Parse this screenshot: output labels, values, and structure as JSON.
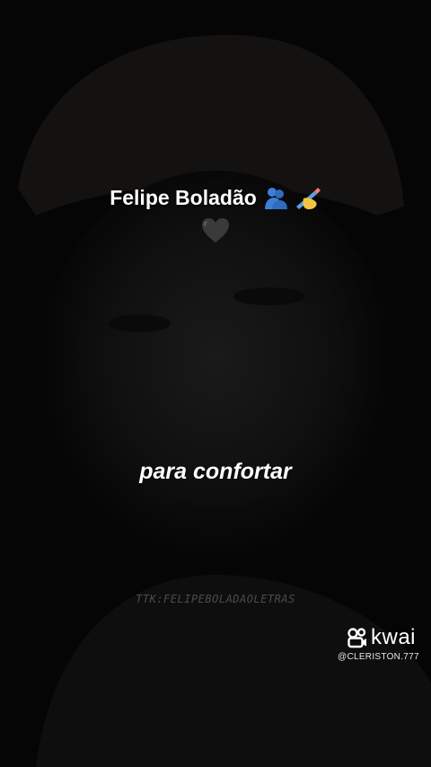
{
  "video": {
    "title": "Felipe Boladão",
    "title_icons": [
      "people-hugging-icon",
      "writing-hand-icon"
    ],
    "second_line_icon": "black-heart-icon",
    "lyric": "para confortar",
    "watermark": "TTK:FELIPEBOLADAOLETRAS"
  },
  "kwai": {
    "logo_text": "kwai",
    "handle": "@CLERISTON.777"
  },
  "colors": {
    "background": "#050505",
    "text": "#ffffff",
    "hug_blue": "#3d7fd6",
    "hand_yellow": "#f5c343",
    "heart_gray": "#3a3a3a"
  }
}
